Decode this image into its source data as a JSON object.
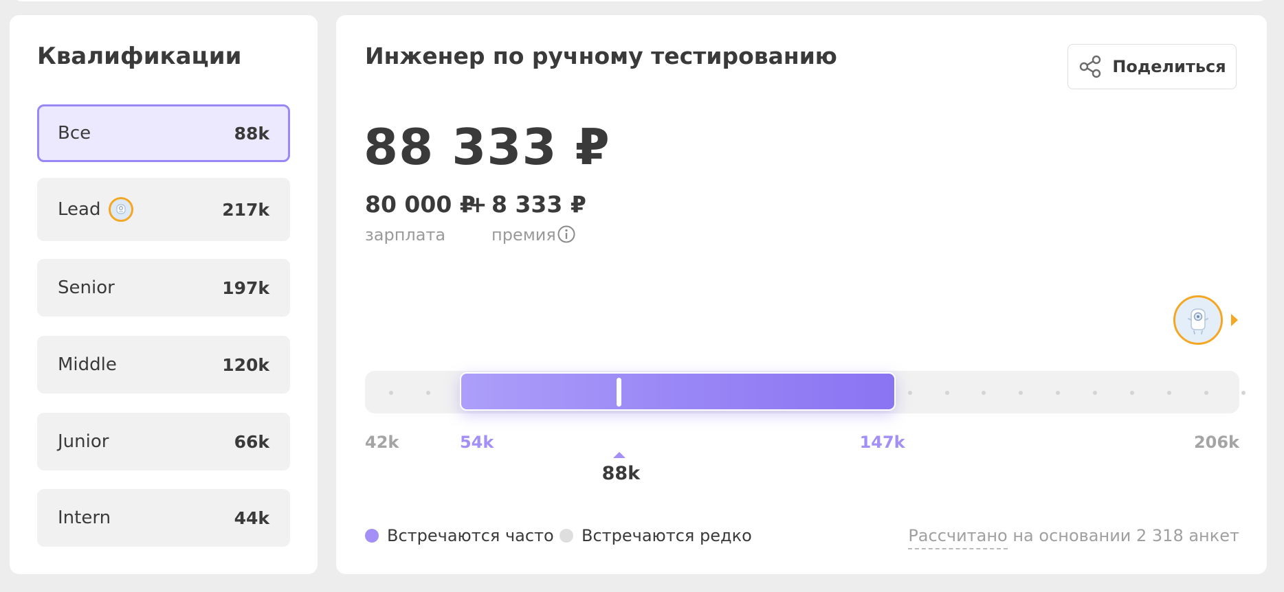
{
  "qualifications": {
    "title": "Квалификации",
    "items": [
      {
        "label": "Все",
        "value": "88k",
        "active": true
      },
      {
        "label": "Lead",
        "value": "217k",
        "badge": "robot-badge"
      },
      {
        "label": "Senior",
        "value": "197k"
      },
      {
        "label": "Middle",
        "value": "120k"
      },
      {
        "label": "Junior",
        "value": "66k"
      },
      {
        "label": "Intern",
        "value": "44k"
      }
    ]
  },
  "main": {
    "title": "Инженер по ручному тестированию",
    "share_label": "Поделиться",
    "total": "88 333 ₽",
    "salary_value": "80 000 ₽",
    "plus": "+",
    "bonus_value": "8 333 ₽",
    "salary_caption": "зарплата",
    "bonus_caption": "премия"
  },
  "range": {
    "min_label": "42k",
    "low_label": "54k",
    "high_label": "147k",
    "max_label": "206k",
    "median_label": "88k",
    "min": 42,
    "low": 54,
    "high": 147,
    "max": 206,
    "median": 88
  },
  "legend": {
    "frequent": "Встречаются часто",
    "rare": "Встречаются редко",
    "frequent_color": "#a38ff6",
    "rare_color": "#dedede"
  },
  "footnote": {
    "link": "Рассчитано",
    "rest": " на основании 2 318 анкет"
  },
  "colors": {
    "accent": "#9a86f4",
    "badge": "#f5a623"
  }
}
